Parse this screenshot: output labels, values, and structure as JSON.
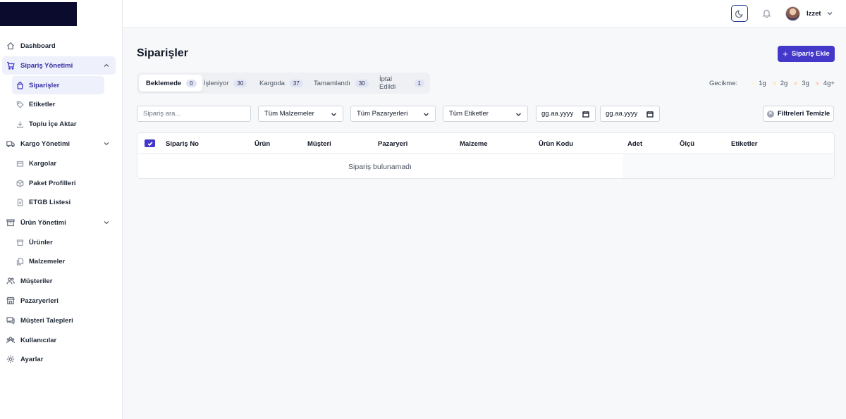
{
  "sidebar": {
    "items": [
      {
        "label": "Dashboard",
        "icon": "home-icon"
      },
      {
        "label": "Sipariş Yönetimi",
        "icon": "cart-icon"
      },
      {
        "label": "Siparişler",
        "icon": "bag-icon"
      },
      {
        "label": "Etiketler",
        "icon": "tag-icon"
      },
      {
        "label": "Toplu İçe Aktar",
        "icon": "download-icon"
      },
      {
        "label": "Kargo Yönetimi",
        "icon": "truck-icon"
      },
      {
        "label": "Kargolar",
        "icon": "package-icon"
      },
      {
        "label": "Paket Profilleri",
        "icon": "box-icon"
      },
      {
        "label": "ETGB Listesi",
        "icon": "document-icon"
      },
      {
        "label": "Ürün Yönetimi",
        "icon": "archive-icon"
      },
      {
        "label": "Ürünler",
        "icon": "product-box-icon"
      },
      {
        "label": "Malzemeler",
        "icon": "documents-icon"
      },
      {
        "label": "Müşteriler",
        "icon": "users-icon"
      },
      {
        "label": "Pazaryerleri",
        "icon": "store-icon"
      },
      {
        "label": "Müşteri Talepleri",
        "icon": "chat-icon"
      },
      {
        "label": "Kullanıcılar",
        "icon": "user-group-icon"
      },
      {
        "label": "Ayarlar",
        "icon": "gear-icon"
      }
    ]
  },
  "header": {
    "username": "Izzet",
    "theme_icon": "moon-icon",
    "notification_icon": "bell-icon"
  },
  "page": {
    "title": "Siparişler",
    "add_button": "Sipariş Ekle"
  },
  "tabs": [
    {
      "label": "Beklemede",
      "count": "0"
    },
    {
      "label": "İşleniyor",
      "count": "30"
    },
    {
      "label": "Kargoda",
      "count": "37"
    },
    {
      "label": "Tamamlandı",
      "count": "30"
    },
    {
      "label": "İptal Edildi",
      "count": "1"
    }
  ],
  "delay": {
    "label": "Gecikme:",
    "levels": [
      {
        "label": "1g",
        "color": "#fdf6d8"
      },
      {
        "label": "2g",
        "color": "#fdecc0"
      },
      {
        "label": "3g",
        "color": "#fde2c4"
      },
      {
        "label": "4g+",
        "color": "#fdd8cf"
      }
    ]
  },
  "filters": {
    "search_placeholder": "Sipariş ara...",
    "materials": "Tüm Malzemeler",
    "marketplaces": "Tüm Pazaryerleri",
    "tags": "Tüm Etiketler",
    "date_from": "gg.aa.yyyy",
    "date_to": "gg.aa.yyyy",
    "clear_button": "Filtreleri Temizle"
  },
  "table": {
    "columns": [
      "Sipariş No",
      "Ürün",
      "Müşteri",
      "Pazaryeri",
      "Malzeme",
      "Ürün Kodu",
      "Adet",
      "Ölçü",
      "Etiketler"
    ],
    "empty_text": "Sipariş bulunamadı"
  },
  "colors": {
    "accent": "#4338ca",
    "active_bg": "#eef0fb",
    "logo": "#0b0b2e"
  }
}
